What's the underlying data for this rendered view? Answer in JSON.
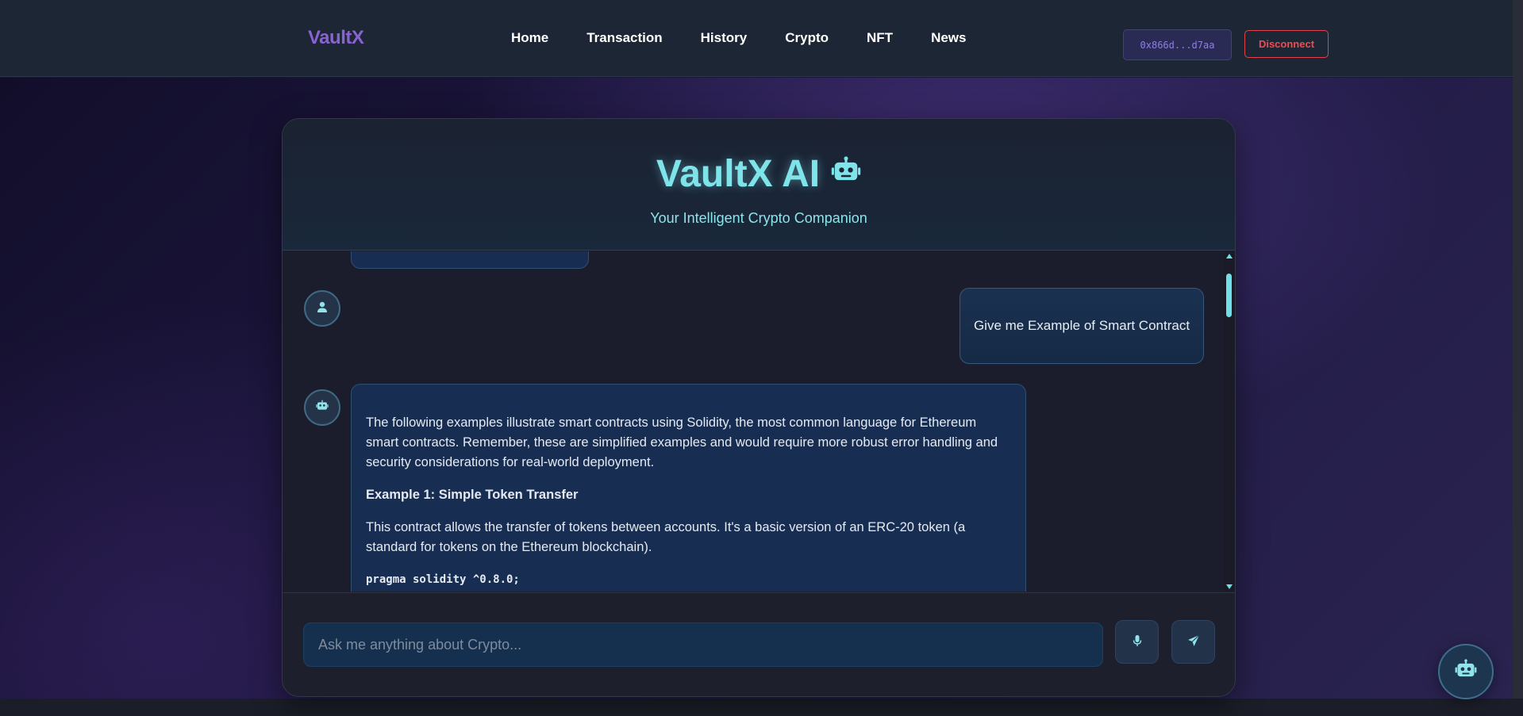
{
  "nav": {
    "brand": "VaultX",
    "links": [
      "Home",
      "Transaction",
      "History",
      "Crypto",
      "NFT",
      "News"
    ],
    "wallet_address": "0x866d...d7aa",
    "disconnect_label": "Disconnect"
  },
  "chat": {
    "title": "VaultX AI",
    "title_icon": "robot-icon",
    "subtitle": "Your Intelligent Crypto Companion",
    "messages": [
      {
        "role": "user",
        "text": "Give me Example of Smart Contract"
      },
      {
        "role": "bot",
        "intro": "The following examples illustrate smart contracts using Solidity, the most common language for Ethereum smart contracts. Remember, these are simplified examples and would require more robust error handling and security considerations for real-world deployment.",
        "heading": "Example 1: Simple Token Transfer",
        "body": "This contract allows the transfer of tokens between accounts. It's a basic version of an ERC-20 token (a standard for tokens on the Ethereum blockchain).",
        "code": "pragma solidity ^0.8.0;"
      }
    ],
    "input_placeholder": "Ask me anything about Crypto...",
    "input_value": ""
  },
  "colors": {
    "brand": "#8a63d2",
    "accent": "#7fe3ea",
    "danger": "#ef4b52"
  }
}
